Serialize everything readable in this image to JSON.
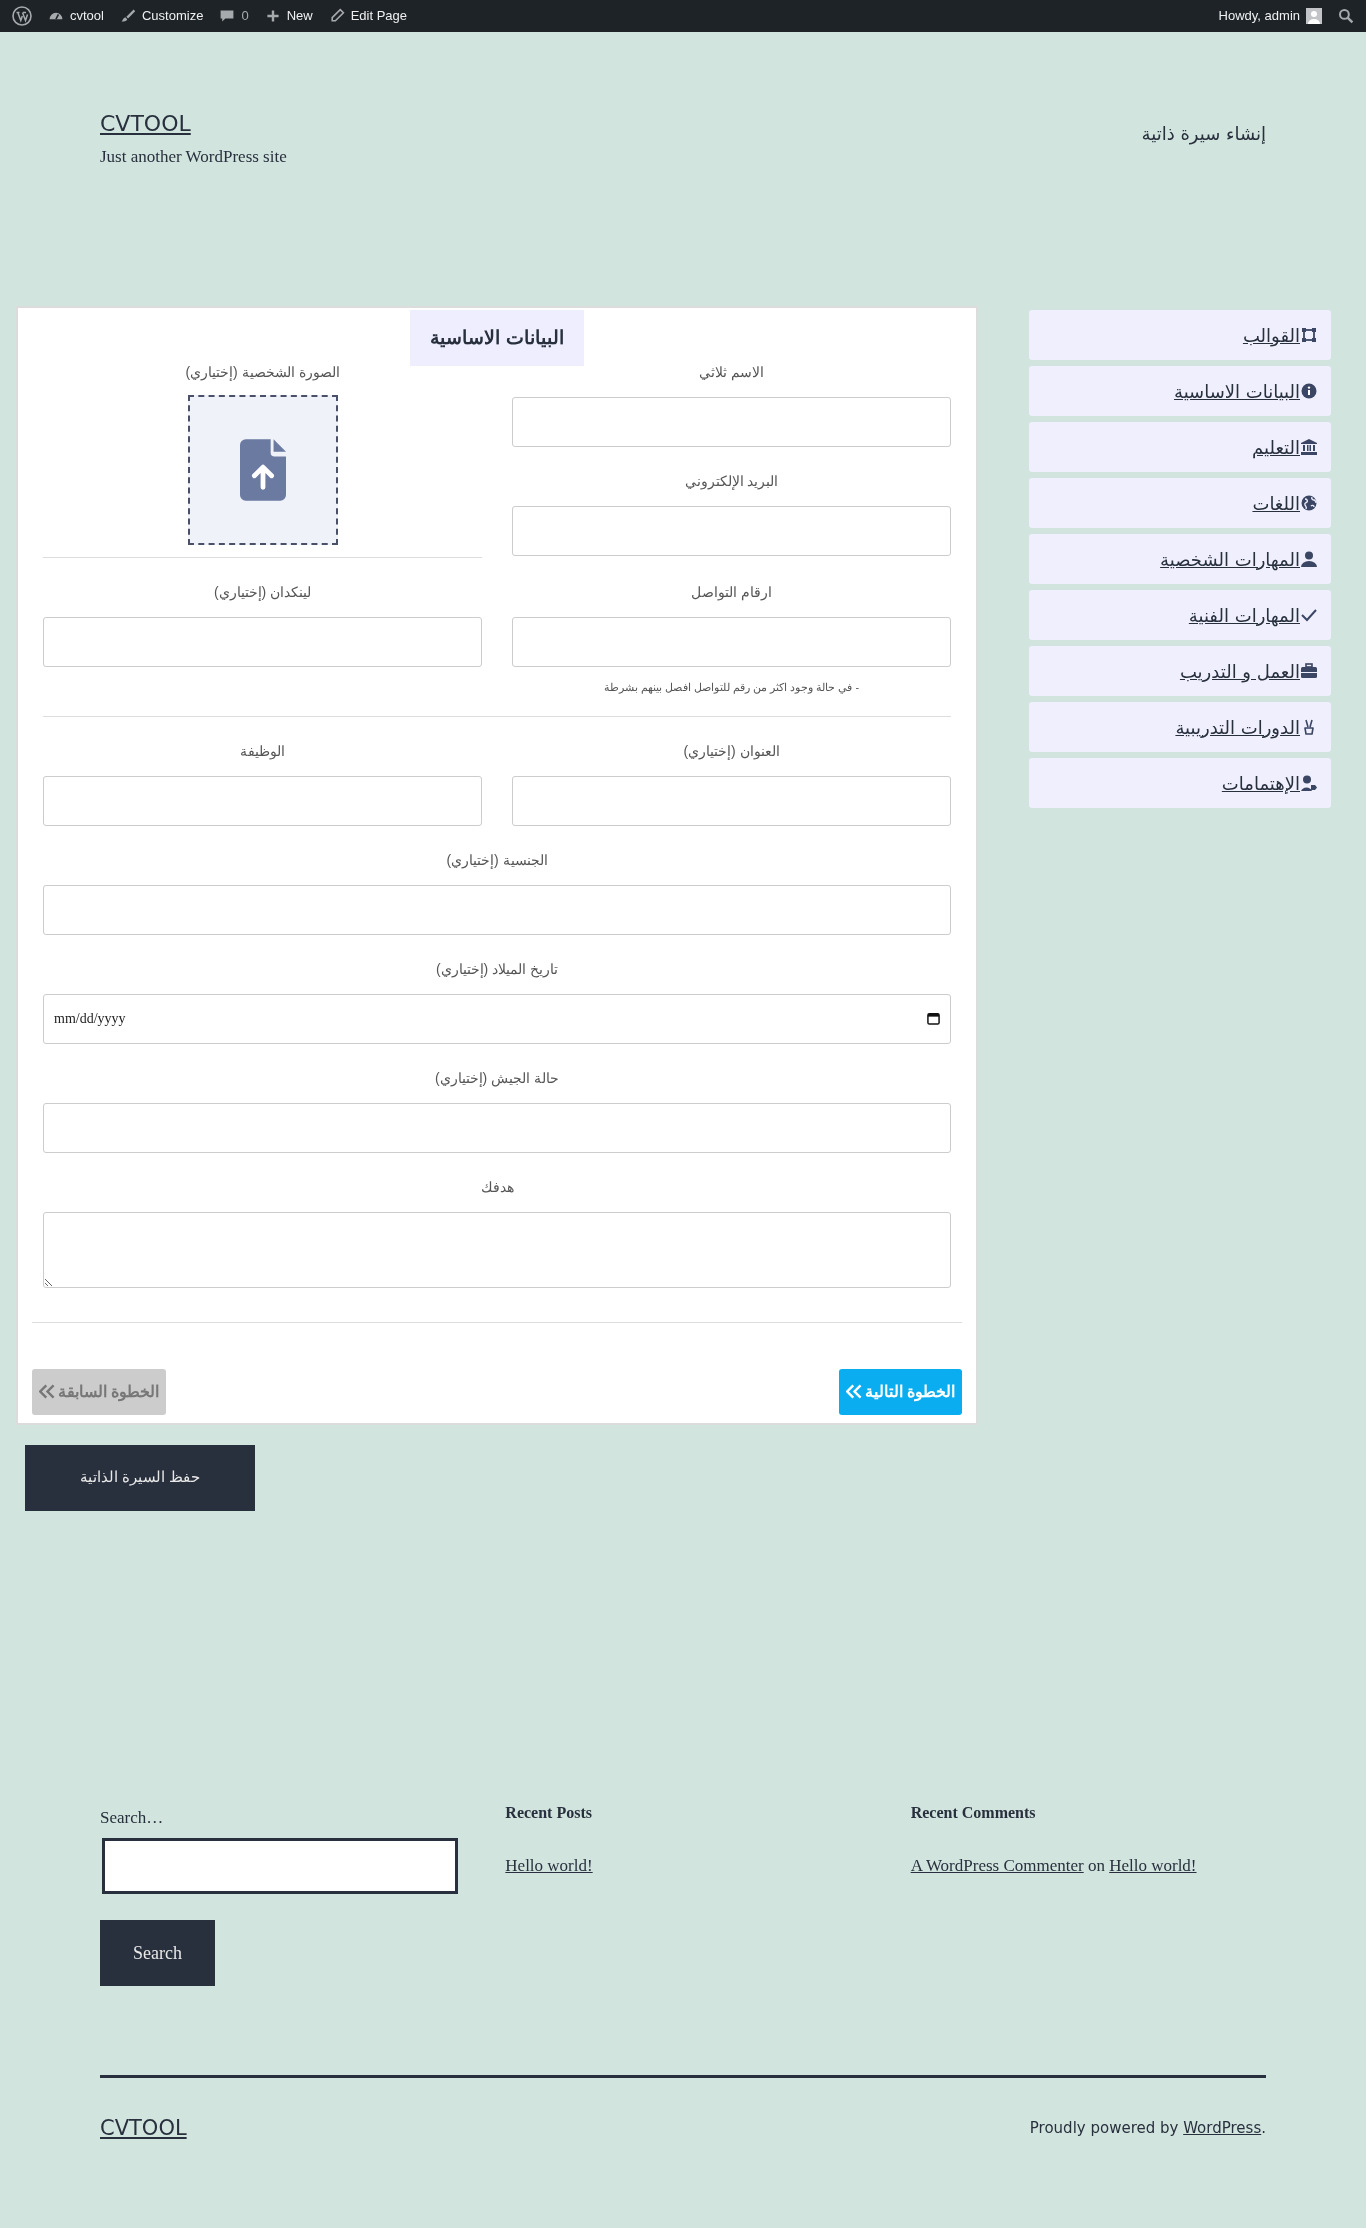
{
  "admin_bar": {
    "site_link": "cvtool",
    "customize_link": "Customize",
    "comments_count": "0",
    "new_link": "New",
    "edit_link": "Edit Page",
    "greeting": "Howdy, admin"
  },
  "header": {
    "site_title": "CVTOOL",
    "tagline": "Just another WordPress site",
    "nav_link": "إنشاء سيرة ذاتية"
  },
  "form": {
    "title": "البيانات الاساسية",
    "name_label": "الاسم ثلاثي",
    "email_label": "البريد الإلكتروني",
    "photo_label": "الصورة الشخصية (إختياري)",
    "contact_label": "ارقام التواصل",
    "contact_hint": "- في حالة وجود اكثر من رقم للتواصل افصل بينهم بشرطة",
    "linkedin_label": "لينكدان (إختياري)",
    "address_label": "العنوان (إختياري)",
    "job_label": "الوظيفة",
    "full_fields": [
      {
        "kind": "text",
        "label": "الجنسية (إختياري)"
      },
      {
        "kind": "date",
        "label": "تاريخ الميلاد (إختياري)",
        "value": "mm/dd/yyyy"
      },
      {
        "kind": "text",
        "label": "حالة الجيش (إختياري)"
      },
      {
        "kind": "textarea",
        "label": "هدفك"
      }
    ],
    "next_button": "الخطوة التالية",
    "prev_button": "الخطوة السابقة"
  },
  "save_button": "حفظ السيرة الذاتية",
  "sidebar": {
    "items": [
      {
        "label": "القوالب"
      },
      {
        "label": "البيانات الاساسية"
      },
      {
        "label": "التعليم"
      },
      {
        "label": "اللغات"
      },
      {
        "label": "المهارات الشخصية"
      },
      {
        "label": "المهارات الفنية"
      },
      {
        "label": "العمل و التدريب"
      },
      {
        "label": "الدورات التدريبية"
      },
      {
        "label": "الإهتمامات"
      }
    ]
  },
  "footer": {
    "search_label": "Search…",
    "search_button": "Search",
    "recent_posts": {
      "title": "Recent Posts",
      "items": [
        "Hello world!"
      ]
    },
    "recent_comments": {
      "title": "Recent Comments",
      "items": [
        {
          "author": "A WordPress Commenter",
          "joiner": "on",
          "post": "Hello world!"
        }
      ]
    },
    "site_title": "CVTOOL",
    "credit": {
      "text": "Proudly powered by",
      "link": "WordPress",
      "end": "."
    }
  }
}
